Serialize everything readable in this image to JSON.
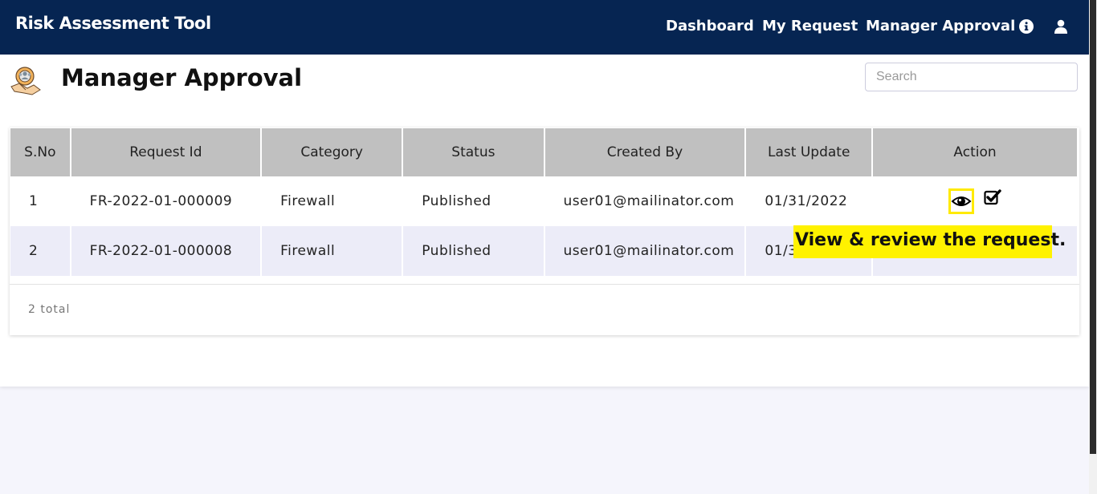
{
  "navbar": {
    "brand": "Risk Assessment Tool",
    "links": [
      "Dashboard",
      "My Request",
      "Manager Approval"
    ],
    "icons": [
      "info-icon",
      "user-icon"
    ],
    "bg_color": "#062552"
  },
  "page": {
    "title": "Manager Approval",
    "icon": "manager-approval-icon",
    "search_placeholder": "Search"
  },
  "table": {
    "headers": [
      "S.No",
      "Request Id",
      "Category",
      "Status",
      "Created By",
      "Last Update",
      "Action"
    ],
    "rows": [
      {
        "sno": "1",
        "request_id": "FR-2022-01-000009",
        "category": "Firewall",
        "status": "Published",
        "created_by": "user01@mailinator.com",
        "last_update": "01/31/2022"
      },
      {
        "sno": "2",
        "request_id": "FR-2022-01-000008",
        "category": "Firewall",
        "status": "Published",
        "created_by": "user01@mailinator.com",
        "last_update": "01/3"
      }
    ],
    "action_icons": [
      "eye-icon",
      "check-square-icon"
    ],
    "total": "2 total"
  },
  "annotation": {
    "text": "View & review the request.",
    "highlight_color": "#fff200"
  }
}
